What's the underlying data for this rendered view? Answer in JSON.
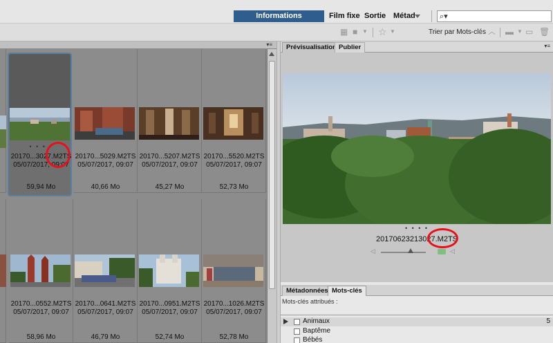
{
  "workspaces": {
    "essentials": "Informations essentielles",
    "film": "Film fixe",
    "sortie": "Sortie",
    "meta": "Métad"
  },
  "search": {
    "placeholder": ""
  },
  "toolbar": {
    "sort_label": "Trier par Mots-clés"
  },
  "thumbnails": [
    {
      "name": "20170...3027.M2TS",
      "date": "05/07/2017, 09:07",
      "size": "59,94 Mo",
      "selected": true
    },
    {
      "name": "20170...5029.M2TS",
      "date": "05/07/2017, 09:07",
      "size": "40,66 Mo"
    },
    {
      "name": "20170...5207.M2TS",
      "date": "05/07/2017, 09:07",
      "size": "45,27 Mo"
    },
    {
      "name": "20170...5520.M2TS",
      "date": "05/07/2017, 09:07",
      "size": "52,73 Mo"
    },
    {
      "name": "20170...0552.M2TS",
      "date": "05/07/2017, 09:07",
      "size": "58,96 Mo"
    },
    {
      "name": "20170...0641.M2TS",
      "date": "05/07/2017, 09:07",
      "size": "46,79 Mo"
    },
    {
      "name": "20170...0951.M2TS",
      "date": "05/07/2017, 09:07",
      "size": "52,74 Mo"
    },
    {
      "name": "20170...1026.M2TS",
      "date": "05/07/2017, 09:07",
      "size": "52,78 Mo"
    }
  ],
  "dots": "• • • •",
  "preview": {
    "tab_preview": "Prévisualisation",
    "tab_publish": "Publier",
    "filename": "20170623213027.M2TS"
  },
  "meta_panel": {
    "tab_meta": "Métadonnées",
    "tab_keywords": "Mots-clés",
    "assigned_label": "Mots-clés attribués :",
    "keywords": [
      {
        "label": "Animaux",
        "count": "5"
      },
      {
        "label": "Baptême",
        "count": ""
      },
      {
        "label": "Bébés",
        "count": ""
      }
    ]
  },
  "colors": {
    "accent": "#2e5d8e",
    "annotation": "#e8101a",
    "content_bg": "#8c8c8c"
  }
}
